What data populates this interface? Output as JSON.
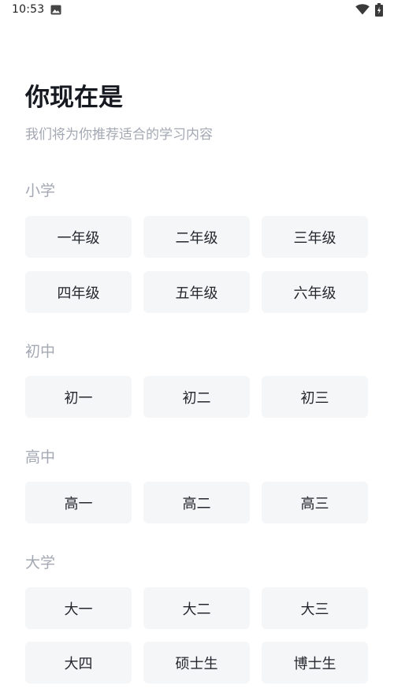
{
  "status_bar": {
    "time": "10:53",
    "icons": [
      "gallery-icon",
      "wifi-icon",
      "battery-icon"
    ]
  },
  "header": {
    "title": "你现在是",
    "subtitle": "我们将为你推荐适合的学习内容"
  },
  "sections": [
    {
      "label": "小学",
      "options": [
        "一年级",
        "二年级",
        "三年级",
        "四年级",
        "五年级",
        "六年级"
      ]
    },
    {
      "label": "初中",
      "options": [
        "初一",
        "初二",
        "初三"
      ]
    },
    {
      "label": "高中",
      "options": [
        "高一",
        "高二",
        "高三"
      ]
    },
    {
      "label": "大学",
      "options": [
        "大一",
        "大二",
        "大三",
        "大四",
        "硕士生",
        "博士生"
      ]
    }
  ],
  "colors": {
    "button_bg": "#f5f6f8",
    "title": "#161a20",
    "muted_text": "#a3a8b2"
  }
}
